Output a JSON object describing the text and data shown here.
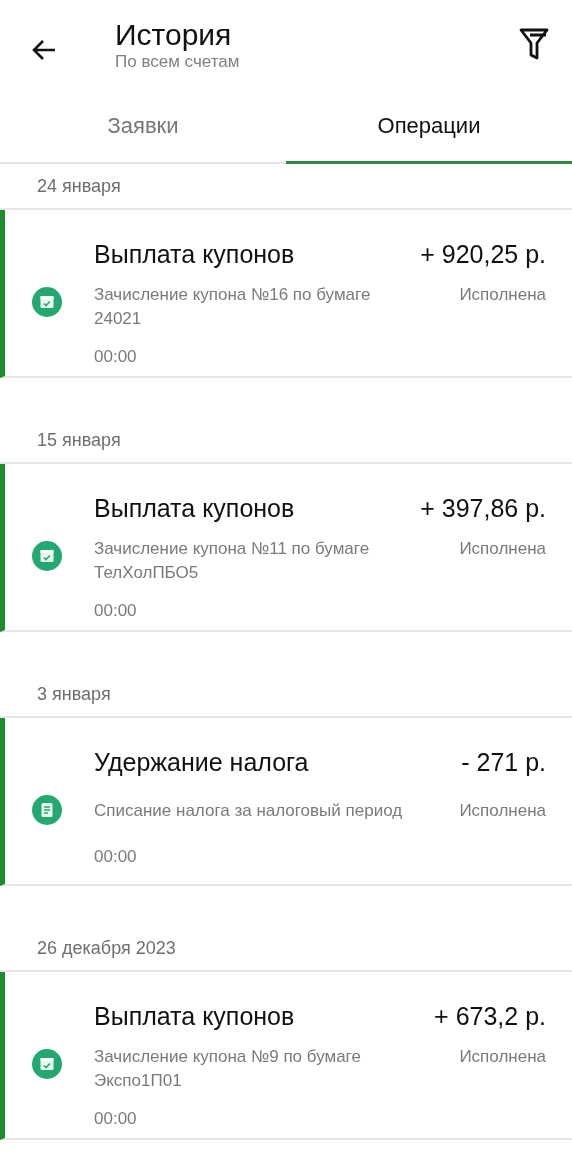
{
  "header": {
    "title": "История",
    "subtitle": "По всем счетам"
  },
  "tabs": [
    {
      "label": "Заявки",
      "selected": false
    },
    {
      "label": "Операции",
      "selected": true
    }
  ],
  "groups": [
    {
      "date": "24 января",
      "operations": [
        {
          "kind": "coupon",
          "title": "Выплата купонов",
          "amount": "+ 920,25 р.",
          "description": "Зачисление купона №16 по бумаге 24021",
          "status": "Исполнена",
          "time": "00:00"
        }
      ]
    },
    {
      "date": "15 января",
      "operations": [
        {
          "kind": "coupon",
          "title": "Выплата купонов",
          "amount": "+ 397,86 р.",
          "description": "Зачисление купона №11 по бумаге ТелХолПБО5",
          "status": "Исполнена",
          "time": "00:00"
        }
      ]
    },
    {
      "date": "3 января",
      "operations": [
        {
          "kind": "tax",
          "title": "Удержание налога",
          "amount": "- 271 р.",
          "description": "Списание налога за налоговый период",
          "status": "Исполнена",
          "time": "00:00"
        }
      ]
    },
    {
      "date": "26 декабря 2023",
      "operations": [
        {
          "kind": "coupon",
          "title": "Выплата купонов",
          "amount": "+ 673,2 р.",
          "description": "Зачисление купона №9 по бумаге Экспо1П01",
          "status": "Исполнена",
          "time": "00:00"
        }
      ]
    }
  ]
}
